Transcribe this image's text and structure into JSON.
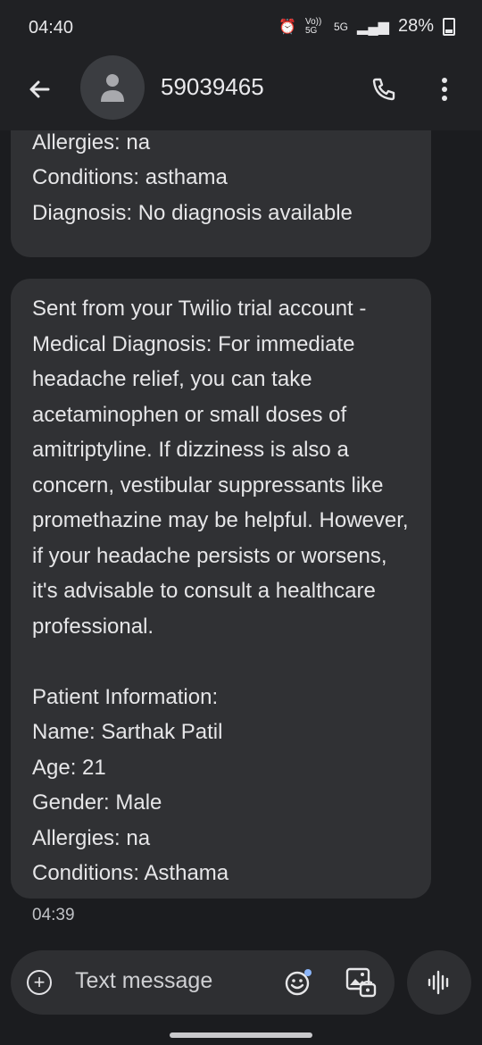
{
  "status_bar": {
    "time": "04:40",
    "network_label": "Vo)) 5G",
    "signal_label": "5G",
    "battery": "28%"
  },
  "header": {
    "contact": "59039465",
    "icons": {
      "back": "arrow-left-icon",
      "avatar": "person-icon",
      "call": "phone-icon",
      "more": "more-vert-icon"
    }
  },
  "messages": [
    {
      "id": "prev",
      "text": "Gender: Male\nAllergies: na\nConditions: asthama\nDiagnosis: No diagnosis available"
    },
    {
      "id": "main",
      "text": "Sent from your Twilio trial account - Medical Diagnosis: For immediate headache relief, you can take acetaminophen or small doses of amitriptyline. If dizziness is also a concern, vestibular suppressants like promethazine may be helpful. However, if your headache persists or worsens, it's advisable to consult a healthcare professional.\n\nPatient Information:\nName: Sarthak Patil\nAge: 21\nGender: Male\nAllergies: na\nConditions: Asthama",
      "time": "04:39"
    }
  ],
  "composer": {
    "placeholder": "Text message"
  },
  "colors": {
    "background": "#1b1c1f",
    "bubble": "#303134",
    "accent": "#8ab4f8"
  }
}
